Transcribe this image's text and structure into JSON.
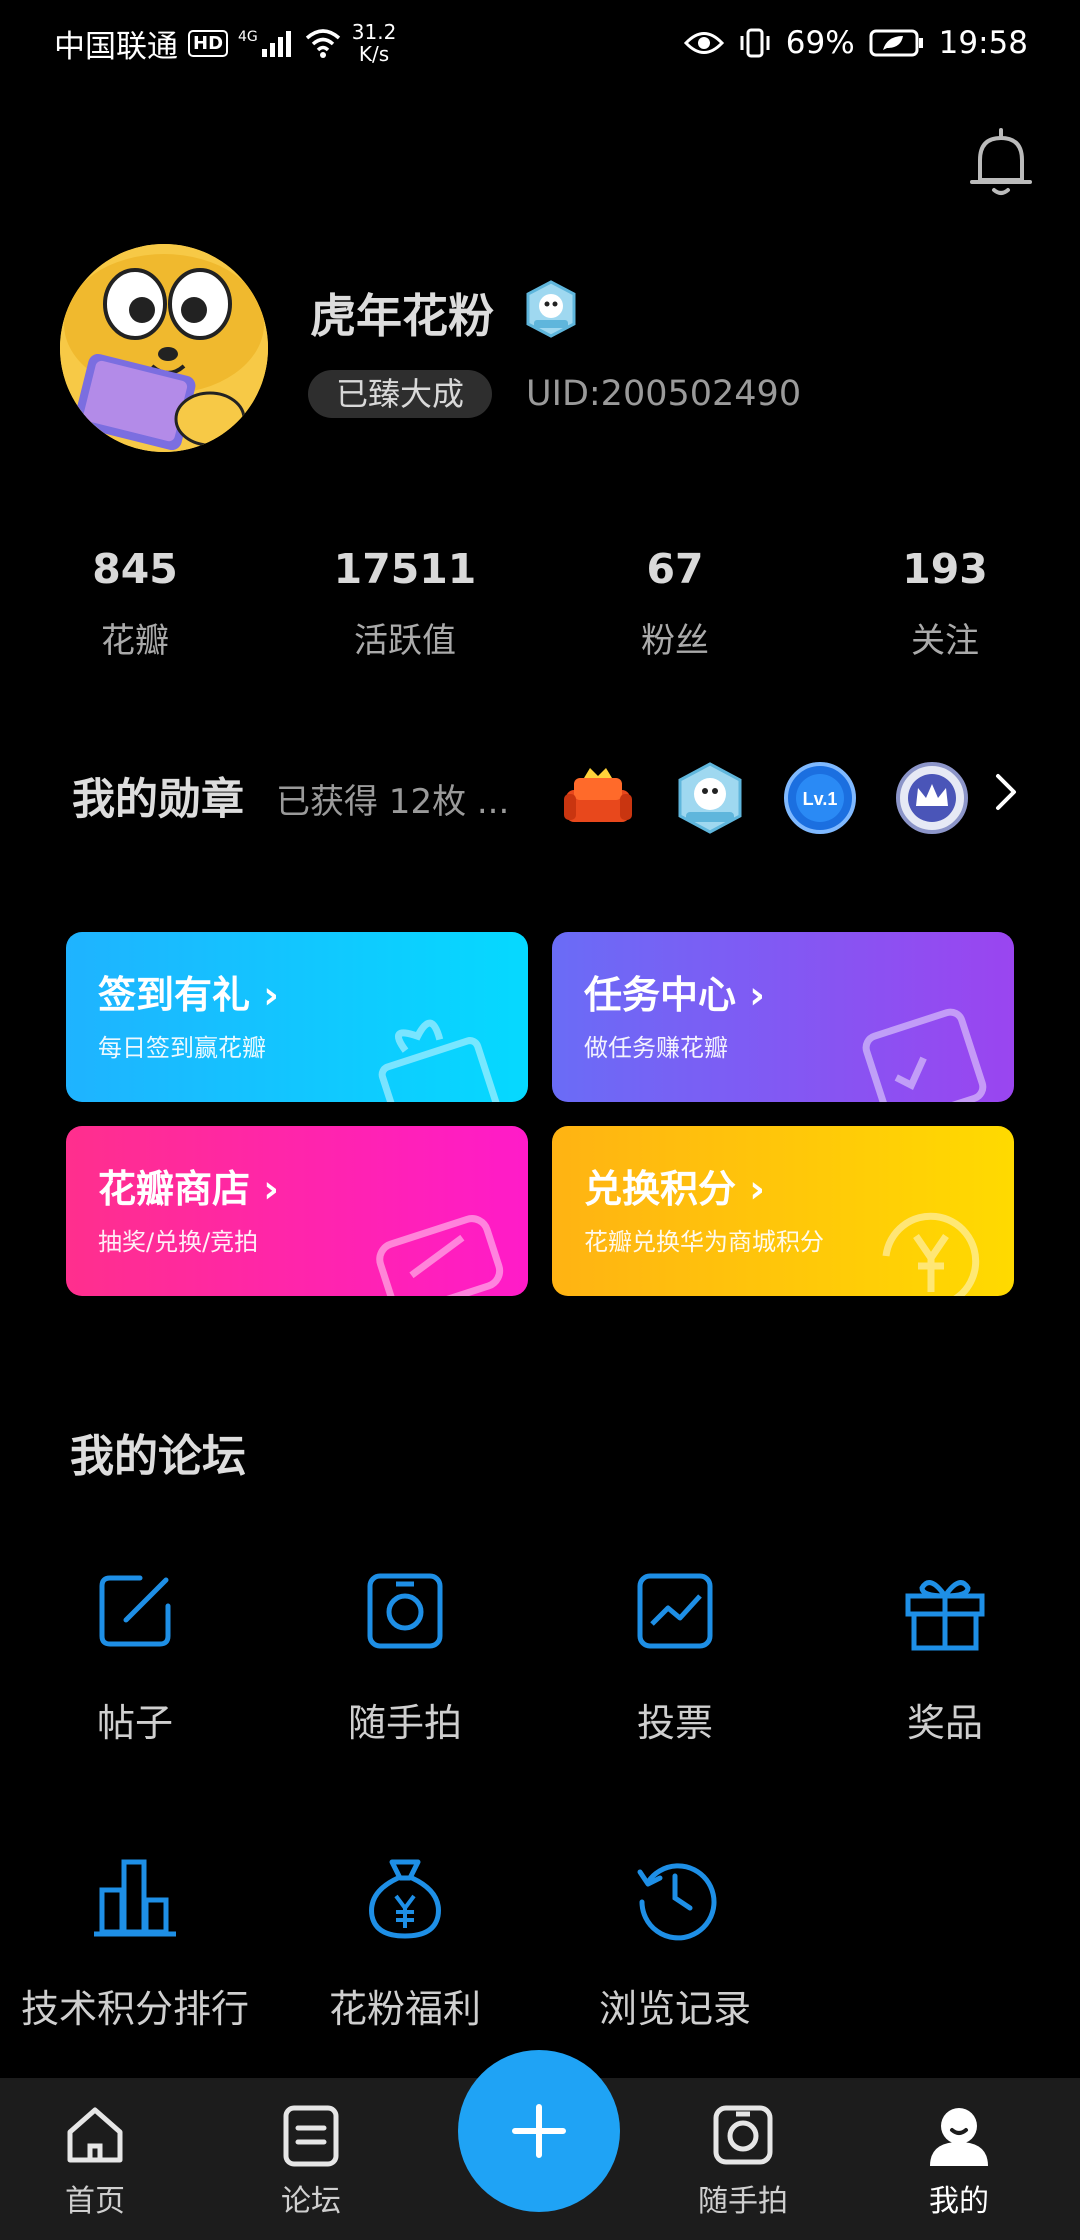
{
  "status_bar": {
    "carrier": "中国联通",
    "hd": "HD",
    "network": "4G",
    "speed_value": "31.2",
    "speed_unit": "K/s",
    "battery": "69%",
    "time": "19:58"
  },
  "profile": {
    "username": "虎年花粉",
    "level": "已臻大成",
    "uid": "UID:200502490"
  },
  "stats": [
    {
      "value": "845",
      "label": "花瓣"
    },
    {
      "value": "17511",
      "label": "活跃值"
    },
    {
      "value": "67",
      "label": "粉丝"
    },
    {
      "value": "193",
      "label": "关注"
    }
  ],
  "medals": {
    "title": "我的勋章",
    "count_text": "已获得 12枚 ...",
    "icons": [
      "sofa-medal-icon",
      "dog-medal-icon",
      "lv1-medal-icon",
      "crown-medal-icon"
    ],
    "lv_text": "Lv.1"
  },
  "cards": [
    {
      "title": "签到有礼 ›",
      "subtitle": "每日签到赢花瓣",
      "color_from": "#1fb3ff",
      "color_to": "#05d9ff"
    },
    {
      "title": "任务中心 ›",
      "subtitle": "做任务赚花瓣",
      "color_from": "#6a6cf6",
      "color_to": "#9a45f0"
    },
    {
      "title": "花瓣商店 ›",
      "subtitle": "抽奖/兑换/竞拍",
      "color_from": "#ff2f8d",
      "color_to": "#ff1bc9"
    },
    {
      "title": "兑换积分 ›",
      "subtitle": "花瓣兑换华为商城积分",
      "color_from": "#ffb313",
      "color_to": "#ffda00"
    }
  ],
  "forum": {
    "title": "我的论坛",
    "items": [
      {
        "label": "帖子",
        "icon": "post-edit-icon"
      },
      {
        "label": "随手拍",
        "icon": "camera-icon"
      },
      {
        "label": "投票",
        "icon": "vote-chart-icon"
      },
      {
        "label": "奖品",
        "icon": "gift-icon"
      },
      {
        "label": "技术积分排行",
        "icon": "bar-ranking-icon"
      },
      {
        "label": "花粉福利",
        "icon": "money-bag-icon"
      },
      {
        "label": "浏览记录",
        "icon": "history-clock-icon"
      }
    ]
  },
  "navbar": {
    "items": [
      {
        "label": "首页",
        "icon": "home-icon"
      },
      {
        "label": "论坛",
        "icon": "forum-icon"
      },
      {
        "label": "随手拍",
        "icon": "camera-icon"
      },
      {
        "label": "我的",
        "icon": "profile-icon"
      }
    ],
    "fab_icon": "plus-icon"
  },
  "colors": {
    "accent_blue": "#1fa3f5",
    "icon_blue": "#1e8fe6",
    "background": "#000000"
  }
}
